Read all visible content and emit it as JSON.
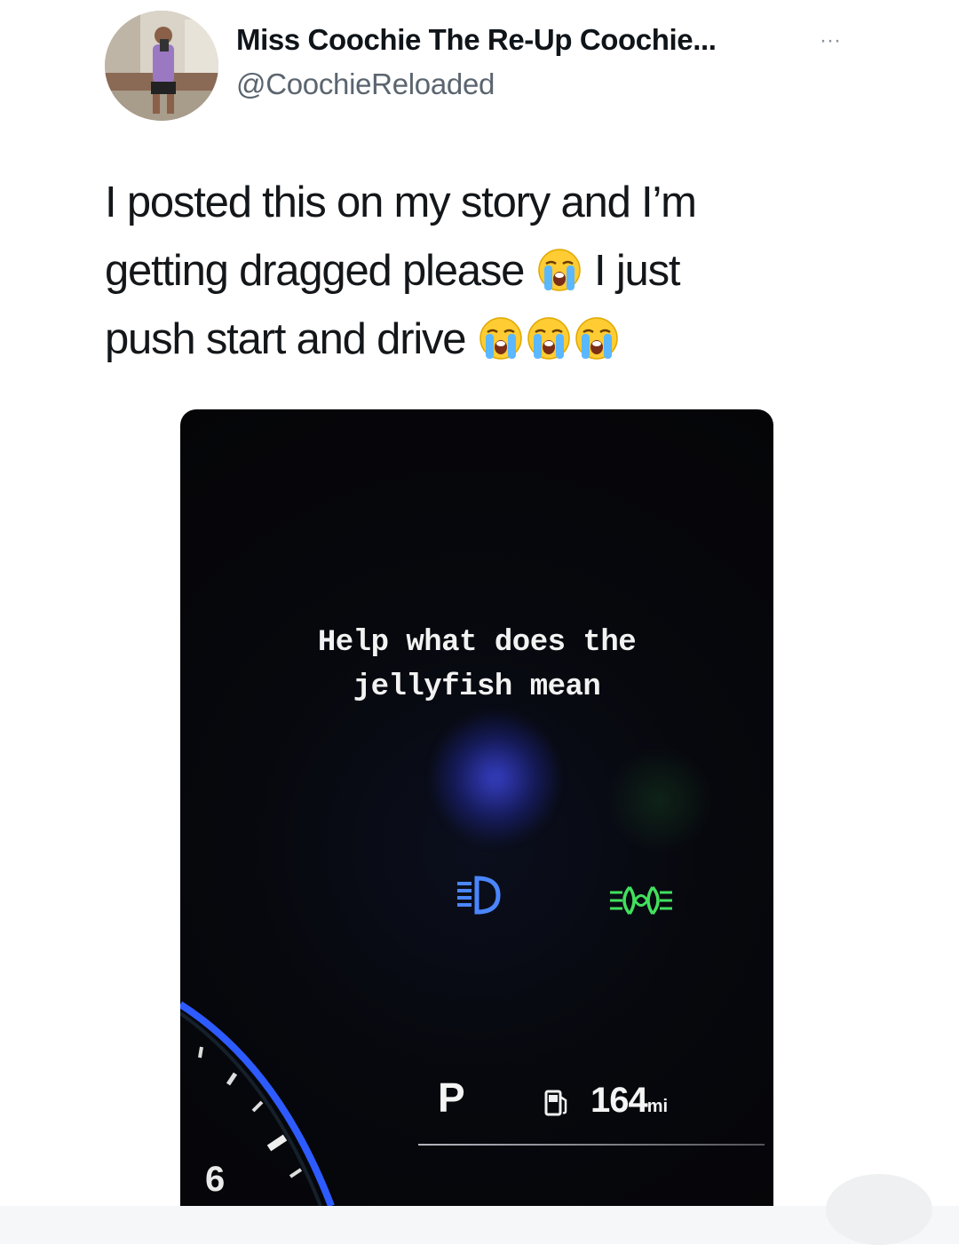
{
  "author": {
    "display_name": "Miss Coochie The Re-Up Coochie...",
    "handle": "@CoochieReloaded",
    "avatar_icon": "profile-photo"
  },
  "menu": {
    "more_label": "···"
  },
  "tweet": {
    "line1": "I posted this on my story and I’m",
    "line2_text": "getting dragged please",
    "line2_after": "I just",
    "line3_text": "push start and drive",
    "emoji_name": "loudly-crying-face"
  },
  "media": {
    "caption_line1": "Help what does the",
    "caption_line2": "jellyfish mean",
    "headlight_icon": "low-beam-headlight-indicator",
    "foglight_icon": "front-fog-light-indicator",
    "gear": "P",
    "range_value": "164",
    "range_unit": "mi",
    "gauge_number": "6",
    "colors": {
      "background": "#06070c",
      "headlight_blue": "#3f7bff",
      "foglight_green": "#3ee05a",
      "gauge_ring": "#2d5bff"
    }
  }
}
